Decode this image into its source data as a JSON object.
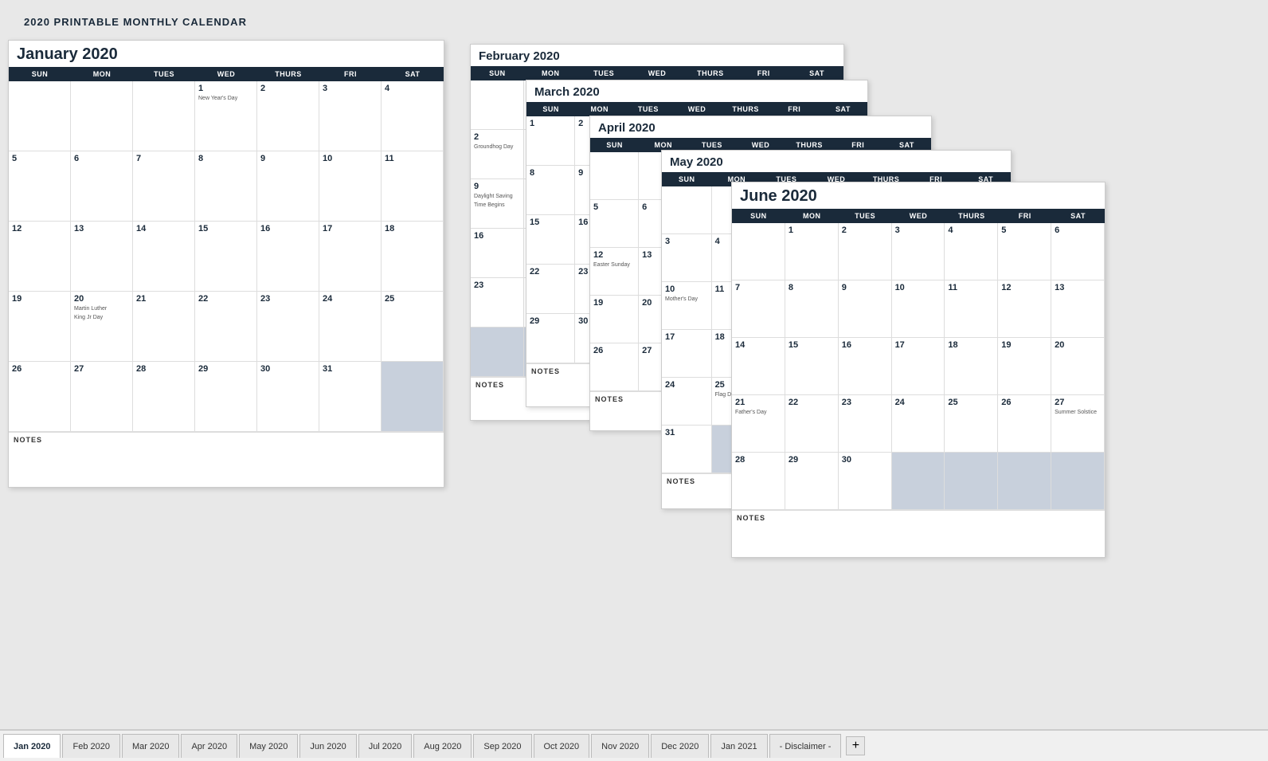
{
  "page": {
    "title": "2020 PRINTABLE MONTHLY CALENDAR"
  },
  "calendars": {
    "january": {
      "title": "January 2020",
      "days": [
        "SUN",
        "MON",
        "TUES",
        "WED",
        "THURS",
        "FRI",
        "SAT"
      ],
      "holidays": {
        "1": "New Year's Day",
        "20": "Martin Luther\nKing Jr Day"
      }
    },
    "february": {
      "title": "February 2020",
      "days": [
        "SUN",
        "MON",
        "TUES",
        "WED",
        "THURS",
        "FRI",
        "SAT"
      ],
      "holidays": {
        "2": "Groundhog Day",
        "9": "Daylight Saving\nTime Begins"
      }
    },
    "march": {
      "title": "March 2020",
      "days": [
        "SUN",
        "MON",
        "TUES",
        "WED",
        "THURS",
        "FRI",
        "SAT"
      ]
    },
    "april": {
      "title": "April 2020",
      "days": [
        "SUN",
        "MON",
        "TUES",
        "WED",
        "THURS",
        "FRI",
        "SAT"
      ],
      "holidays": {
        "12": "Easter Sunday"
      }
    },
    "may": {
      "title": "May 2020",
      "days": [
        "SUN",
        "MON",
        "TUES",
        "WED",
        "THURS",
        "FRI",
        "SAT"
      ],
      "holidays": {
        "10": "Mother's Day",
        "25": "Flag Day"
      }
    },
    "june": {
      "title": "June 2020",
      "days": [
        "SUN",
        "MON",
        "TUES",
        "WED",
        "THURS",
        "FRI",
        "SAT"
      ],
      "holidays": {
        "21": "Father's Day",
        "27": "Summer Solstice"
      }
    }
  },
  "tabs": [
    {
      "label": "Jan 2020",
      "active": true
    },
    {
      "label": "Feb 2020",
      "active": false
    },
    {
      "label": "Mar 2020",
      "active": false
    },
    {
      "label": "Apr 2020",
      "active": false
    },
    {
      "label": "May 2020",
      "active": false
    },
    {
      "label": "Jun 2020",
      "active": false
    },
    {
      "label": "Jul 2020",
      "active": false
    },
    {
      "label": "Aug 2020",
      "active": false
    },
    {
      "label": "Sep 2020",
      "active": false
    },
    {
      "label": "Oct 2020",
      "active": false
    },
    {
      "label": "Nov 2020",
      "active": false
    },
    {
      "label": "Dec 2020",
      "active": false
    },
    {
      "label": "Jan 2021",
      "active": false
    },
    {
      "label": "- Disclaimer -",
      "active": false
    }
  ]
}
